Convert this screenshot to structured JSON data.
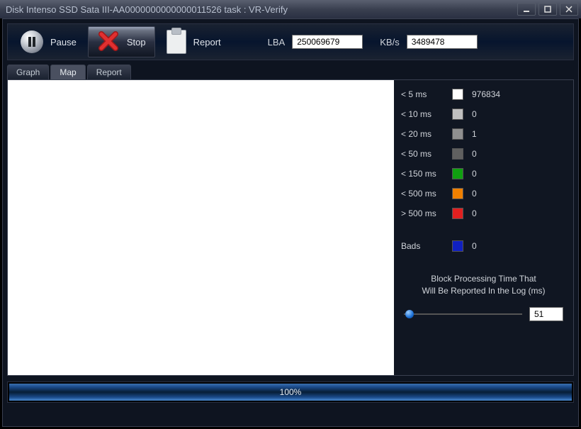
{
  "window": {
    "title": "Disk Intenso SSD Sata III-AA0000000000000011526   task : VR-Verify"
  },
  "toolbar": {
    "pause": "Pause",
    "stop": "Stop",
    "report": "Report",
    "lba_label": "LBA",
    "lba_value": "250069679",
    "kbs_label": "KB/s",
    "kbs_value": "3489478"
  },
  "tabs": {
    "graph": "Graph",
    "map": "Map",
    "report": "Report",
    "active": "Map"
  },
  "legend": {
    "items": [
      {
        "label": "< 5 ms",
        "color": "#ffffff",
        "count": "976834"
      },
      {
        "label": "< 10 ms",
        "color": "#c0c0c0",
        "count": "0"
      },
      {
        "label": "< 20 ms",
        "color": "#909090",
        "count": "1"
      },
      {
        "label": "< 50 ms",
        "color": "#606060",
        "count": "0"
      },
      {
        "label": "< 150 ms",
        "color": "#10a010",
        "count": "0"
      },
      {
        "label": "< 500 ms",
        "color": "#f08000",
        "count": "0"
      },
      {
        "label": "> 500 ms",
        "color": "#e02020",
        "count": "0"
      }
    ],
    "bads": {
      "label": "Bads",
      "color": "#1020c0",
      "count": "0"
    },
    "report_text1": "Block Processing Time That",
    "report_text2": "Will Be Reported In the Log (ms)",
    "slider_value": "51"
  },
  "progress": {
    "percent": "100%"
  }
}
